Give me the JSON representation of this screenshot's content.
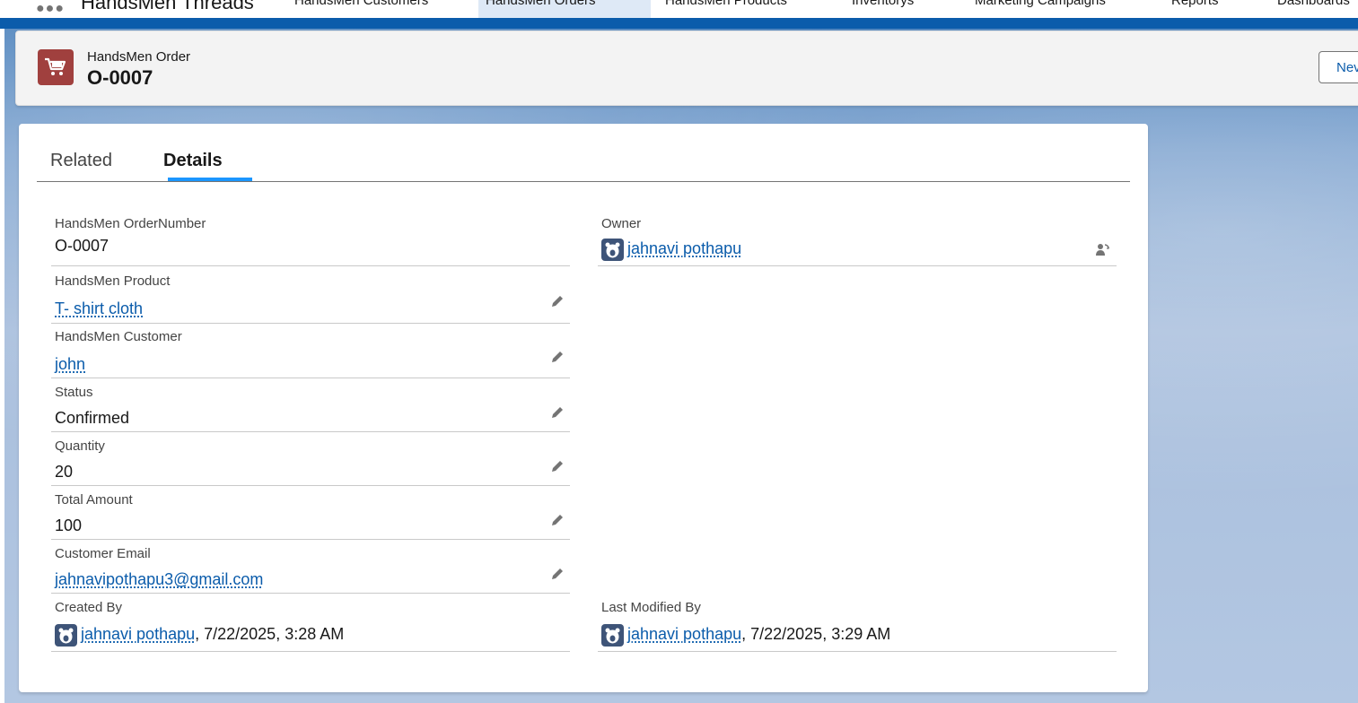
{
  "nav": {
    "app_name": "HandsMen Threads",
    "items": [
      {
        "label": "HandsMen Customers"
      },
      {
        "label": "HandsMen Orders"
      },
      {
        "label": "HandsMen Products"
      },
      {
        "label": "Inventorys"
      },
      {
        "label": "Marketing Campaigns"
      },
      {
        "label": "Reports"
      },
      {
        "label": "Dashboards"
      }
    ]
  },
  "header": {
    "object_type": "HandsMen Order",
    "record_name": "O-0007",
    "new_button": "Nev"
  },
  "tabs": {
    "related": "Related",
    "details": "Details"
  },
  "fields": {
    "order_number": {
      "label": "HandsMen OrderNumber",
      "value": "O-0007"
    },
    "owner": {
      "label": "Owner",
      "value": "jahnavi pothapu"
    },
    "product": {
      "label": "HandsMen Product",
      "value": "T- shirt cloth"
    },
    "customer": {
      "label": "HandsMen Customer",
      "value": "john"
    },
    "status": {
      "label": "Status",
      "value": "Confirmed"
    },
    "quantity": {
      "label": "Quantity",
      "value": "20"
    },
    "total_amount": {
      "label": "Total Amount",
      "value": "100"
    },
    "customer_email": {
      "label": "Customer Email",
      "value": "jahnavipothapu3@gmail.com"
    },
    "created_by": {
      "label": "Created By",
      "user": "jahnavi pothapu",
      "timestamp": ", 7/22/2025, 3:28 AM"
    },
    "last_modified_by": {
      "label": "Last Modified By",
      "user": "jahnavi pothapu",
      "timestamp": ", 7/22/2025, 3:29 AM"
    }
  },
  "colors": {
    "brand": "#0b5cab",
    "order_icon": "#a0403e",
    "tab_active": "#1b96ff"
  }
}
